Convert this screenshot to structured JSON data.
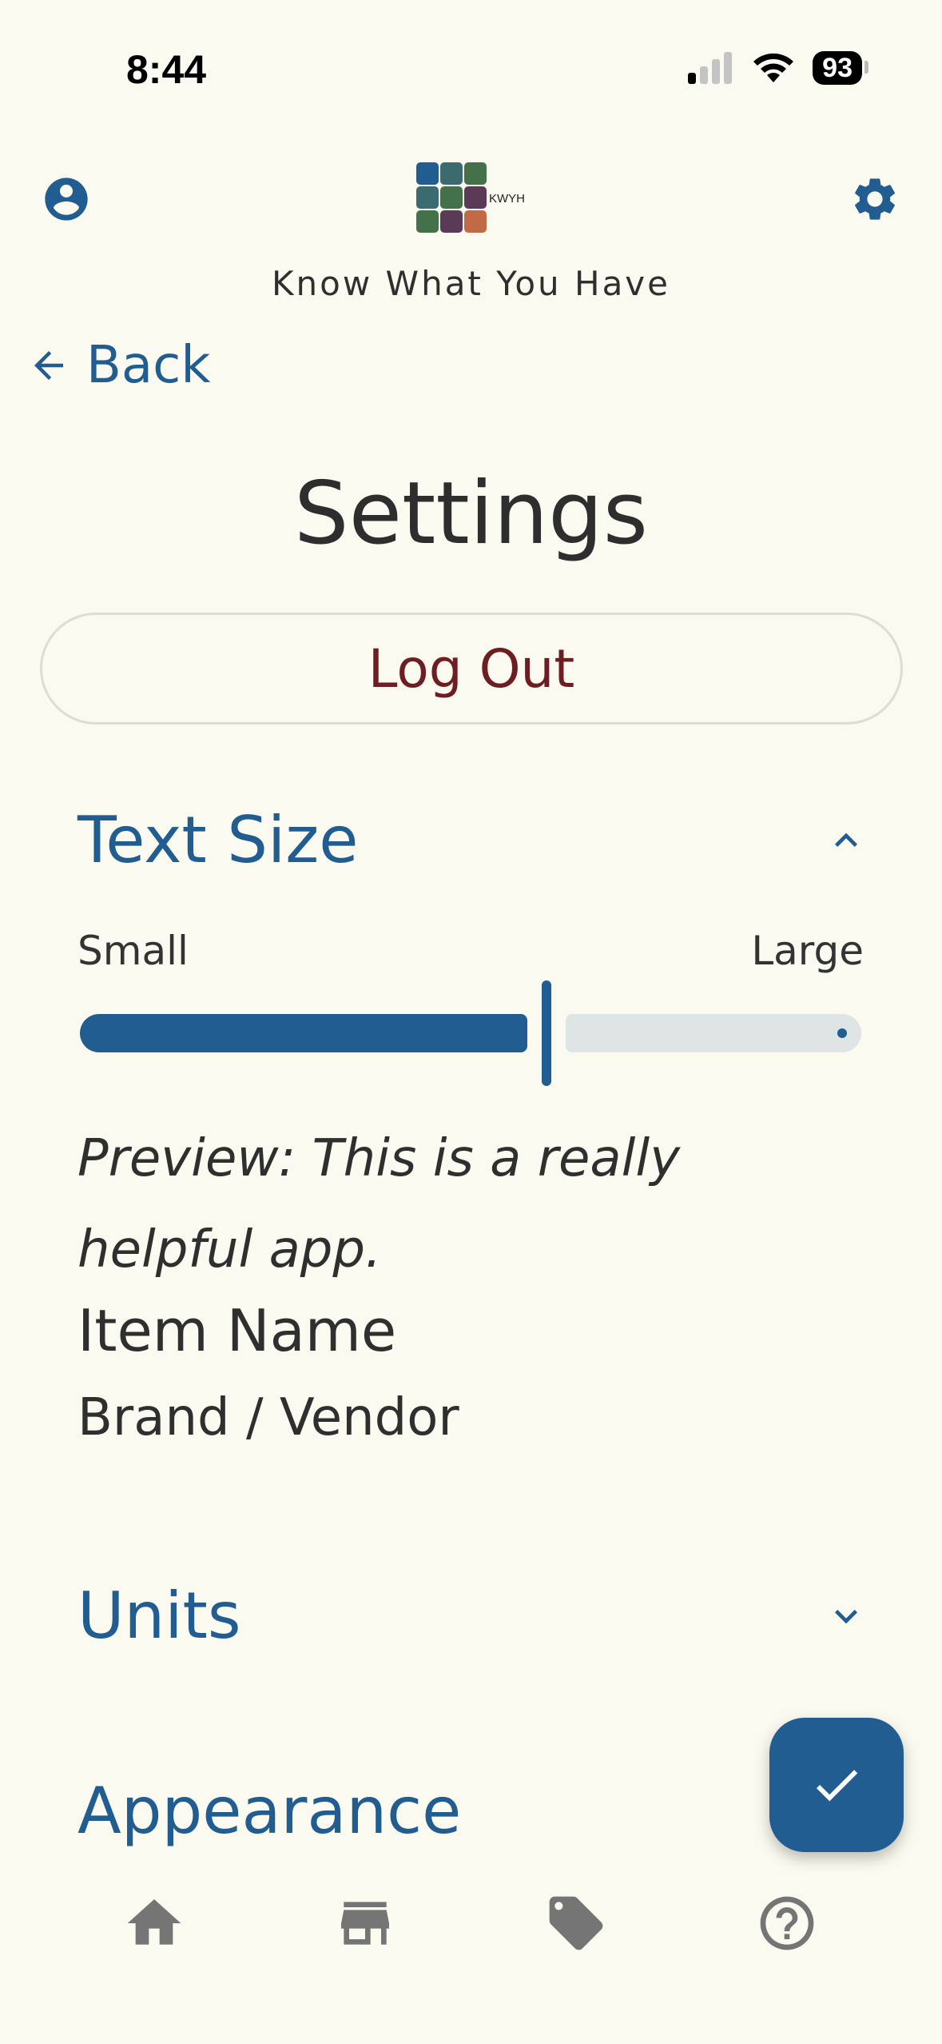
{
  "status_bar": {
    "time": "8:44",
    "battery": "93"
  },
  "header": {
    "app_title": "Know What You Have",
    "logo_text": "KWYH",
    "icons": {
      "profile": "account-circle-icon",
      "settings": "gear-icon"
    }
  },
  "nav": {
    "back_label": "Back"
  },
  "page": {
    "title": "Settings",
    "logout_label": "Log Out"
  },
  "text_size": {
    "title": "Text Size",
    "expanded": true,
    "min_label": "Small",
    "max_label": "Large",
    "slider_value_fraction": 0.6,
    "preview_text": "Preview: This is a really helpful app.",
    "sample_item_name": "Item Name",
    "sample_brand": "Brand / Vendor"
  },
  "units": {
    "title": "Units",
    "expanded": false
  },
  "appearance": {
    "title": "Appearance"
  },
  "fab": {
    "icon": "check-icon"
  },
  "bottom_nav": {
    "items": [
      {
        "icon": "home-icon"
      },
      {
        "icon": "store-icon"
      },
      {
        "icon": "tag-icon"
      },
      {
        "icon": "help-circle-icon"
      }
    ]
  },
  "colors": {
    "primary": "#215d91",
    "background": "#fbfaf0",
    "logout_text": "#6e1e22",
    "nav_icon": "#757575",
    "slider_track": "#dfe4e4"
  }
}
